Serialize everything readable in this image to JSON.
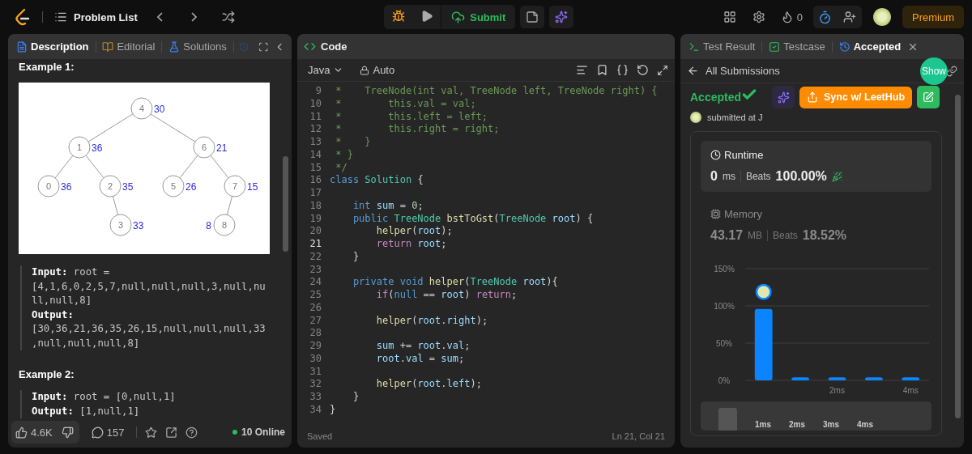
{
  "top_bar": {
    "title": "Problem List",
    "submit_label": "Submit",
    "streak": "0",
    "premium": "Premium"
  },
  "description_panel": {
    "tabs": [
      {
        "label": "Description",
        "kind": "description",
        "selected": true
      },
      {
        "label": "Editorial",
        "kind": "editorial",
        "selected": false
      },
      {
        "label": "Solutions",
        "kind": "solutions",
        "selected": false
      }
    ],
    "example_1": {
      "heading": "Example 1:",
      "tree": {
        "value": "4",
        "label": "30",
        "children": [
          {
            "right_child": false,
            "value": "1",
            "label": "36",
            "children": [
              {
                "right_child": false,
                "value": "0",
                "label": "36"
              },
              {
                "right_child": true,
                "value": "2",
                "label": "35",
                "children": [
                  {
                    "right_child": true,
                    "value": "3",
                    "label": "33"
                  }
                ]
              }
            ]
          },
          {
            "right_child": true,
            "value": "6",
            "label": "21",
            "children": [
              {
                "right_child": false,
                "value": "5",
                "label": "26"
              },
              {
                "right_child": true,
                "value": "7",
                "label": "15",
                "children": [
                  {
                    "right_child": false,
                    "value": "8",
                    "label": "8"
                  }
                ]
              }
            ]
          }
        ]
      },
      "lines": [
        "**Input:** root = [4,1,6,0,2,5,7,null,null,null,3,null,null,null,8]",
        "**Output:** [30,36,21,36,35,26,15,null,null,null,33,null,null,null,8]"
      ]
    },
    "example_2": {
      "heading": "Example 2:",
      "lines": [
        "**Input:** root = [0,null,1]",
        "**Output:** [1,null,1]"
      ]
    },
    "footer": {
      "likes": "4.6K",
      "comments": "157",
      "online": "10 Online"
    }
  },
  "code_panel": {
    "title": "Code",
    "language": "Java",
    "mode": "Auto",
    "lines": [
      {
        "num": "9",
        "current": false,
        "tokens": [
          {
            "kind": "comment",
            "text": " *    TreeNode(int val, TreeNode left, TreeNode right) {"
          }
        ]
      },
      {
        "num": "10",
        "current": false,
        "tokens": [
          {
            "kind": "comment",
            "text": " *        this.val = val;"
          }
        ]
      },
      {
        "num": "11",
        "current": false,
        "tokens": [
          {
            "kind": "comment",
            "text": " *        this.left = left;"
          }
        ]
      },
      {
        "num": "12",
        "current": false,
        "tokens": [
          {
            "kind": "comment",
            "text": " *        this.right = right;"
          }
        ]
      },
      {
        "num": "13",
        "current": false,
        "tokens": [
          {
            "kind": "comment",
            "text": " *    }"
          }
        ]
      },
      {
        "num": "14",
        "current": false,
        "tokens": [
          {
            "kind": "comment",
            "text": " * }"
          }
        ]
      },
      {
        "num": "15",
        "current": false,
        "tokens": [
          {
            "kind": "comment",
            "text": " */"
          }
        ]
      },
      {
        "num": "16",
        "current": false,
        "tokens": [
          {
            "kind": "keyword",
            "text": "class"
          },
          {
            "kind": "type",
            "text": " Solution"
          },
          {
            "kind": "plain",
            "text": " {"
          }
        ]
      },
      {
        "num": "17",
        "current": false
      },
      {
        "num": "18",
        "current": false,
        "tokens": [
          {
            "kind": "keyword",
            "text": "    int"
          },
          {
            "kind": "variable",
            "text": " sum"
          },
          {
            "kind": "plain",
            "text": " = "
          },
          {
            "kind": "number",
            "text": "0"
          },
          {
            "kind": "plain",
            "text": ";"
          }
        ]
      },
      {
        "num": "19",
        "current": false,
        "tokens": [
          {
            "kind": "keyword",
            "text": "    public"
          },
          {
            "kind": "type",
            "text": " TreeNode"
          },
          {
            "kind": "function",
            "text": " bstToGst"
          },
          {
            "kind": "plain",
            "text": "("
          },
          {
            "kind": "type",
            "text": "TreeNode"
          },
          {
            "kind": "variable",
            "text": " root"
          },
          {
            "kind": "plain",
            "text": ") {"
          }
        ]
      },
      {
        "num": "20",
        "current": false,
        "tokens": [
          {
            "kind": "function",
            "text": "        helper"
          },
          {
            "kind": "plain",
            "text": "("
          },
          {
            "kind": "variable",
            "text": "root"
          },
          {
            "kind": "plain",
            "text": ");"
          }
        ]
      },
      {
        "num": "21",
        "current": true,
        "tokens": [
          {
            "kind": "control",
            "text": "        return"
          },
          {
            "kind": "variable",
            "text": " root"
          },
          {
            "kind": "plain",
            "text": ";"
          }
        ]
      },
      {
        "num": "22",
        "current": false,
        "tokens": [
          {
            "kind": "plain",
            "text": "    }"
          }
        ]
      },
      {
        "num": "23",
        "current": false
      },
      {
        "num": "24",
        "current": false,
        "tokens": [
          {
            "kind": "keyword",
            "text": "    private void"
          },
          {
            "kind": "function",
            "text": " helper"
          },
          {
            "kind": "plain",
            "text": "("
          },
          {
            "kind": "type",
            "text": "TreeNode"
          },
          {
            "kind": "variable",
            "text": " root"
          },
          {
            "kind": "plain",
            "text": "){"
          }
        ]
      },
      {
        "num": "25",
        "current": false,
        "tokens": [
          {
            "kind": "control",
            "text": "        if"
          },
          {
            "kind": "plain",
            "text": "("
          },
          {
            "kind": "keyword",
            "text": "null"
          },
          {
            "kind": "plain",
            "text": " == "
          },
          {
            "kind": "variable",
            "text": "root"
          },
          {
            "kind": "plain",
            "text": ") "
          },
          {
            "kind": "control",
            "text": "return"
          },
          {
            "kind": "plain",
            "text": ";"
          }
        ]
      },
      {
        "num": "26",
        "current": false
      },
      {
        "num": "27",
        "current": false,
        "tokens": [
          {
            "kind": "function",
            "text": "        helper"
          },
          {
            "kind": "plain",
            "text": "("
          },
          {
            "kind": "variable",
            "text": "root"
          },
          {
            "kind": "plain",
            "text": "."
          },
          {
            "kind": "variable",
            "text": "right"
          },
          {
            "kind": "plain",
            "text": ");"
          }
        ]
      },
      {
        "num": "28",
        "current": false
      },
      {
        "num": "29",
        "current": false,
        "tokens": [
          {
            "kind": "variable",
            "text": "        sum"
          },
          {
            "kind": "plain",
            "text": " += "
          },
          {
            "kind": "variable",
            "text": "root"
          },
          {
            "kind": "plain",
            "text": "."
          },
          {
            "kind": "variable",
            "text": "val"
          },
          {
            "kind": "plain",
            "text": ";"
          }
        ]
      },
      {
        "num": "30",
        "current": false,
        "tokens": [
          {
            "kind": "variable",
            "text": "        root"
          },
          {
            "kind": "plain",
            "text": "."
          },
          {
            "kind": "variable",
            "text": "val"
          },
          {
            "kind": "plain",
            "text": " = "
          },
          {
            "kind": "variable",
            "text": "sum"
          },
          {
            "kind": "plain",
            "text": ";"
          }
        ]
      },
      {
        "num": "31",
        "current": false
      },
      {
        "num": "32",
        "current": false,
        "tokens": [
          {
            "kind": "function",
            "text": "        helper"
          },
          {
            "kind": "plain",
            "text": "("
          },
          {
            "kind": "variable",
            "text": "root"
          },
          {
            "kind": "plain",
            "text": "."
          },
          {
            "kind": "variable",
            "text": "left"
          },
          {
            "kind": "plain",
            "text": ");"
          }
        ]
      },
      {
        "num": "33",
        "current": false,
        "tokens": [
          {
            "kind": "plain",
            "text": "    }"
          }
        ]
      },
      {
        "num": "34",
        "current": false,
        "tokens": [
          {
            "kind": "plain",
            "text": "}"
          }
        ]
      }
    ],
    "status": "Saved",
    "cursor": "Ln 21, Col 21"
  },
  "result_panel": {
    "tabs": [
      {
        "label": "Test Result",
        "kind": "terminal",
        "selected": false,
        "closable": false
      },
      {
        "label": "Testcase",
        "kind": "testcase",
        "selected": false,
        "closable": false
      },
      {
        "label": "Accepted",
        "kind": "history",
        "selected": true,
        "closable": true
      }
    ],
    "back_link": "All Submissions",
    "show_button": "Show",
    "status": "Accepted",
    "sync_button": "Sync w/ LeetHub",
    "submitted": "submitted at J",
    "metrics": [
      {
        "kind": "runtime",
        "title": "Runtime",
        "value": "0",
        "unit": "ms",
        "beats_label": "Beats",
        "beats": "100.00%",
        "selected": true
      },
      {
        "kind": "memory",
        "title": "Memory",
        "value": "43.17",
        "unit": "MB",
        "beats_label": "Beats",
        "beats": "18.52%",
        "selected": false
      }
    ],
    "chart_data": {
      "type": "bar",
      "x": [
        0,
        1,
        2,
        3,
        4
      ],
      "values": [
        96,
        4,
        4,
        4,
        4
      ],
      "xlim": [
        -0.5,
        4.5
      ],
      "ylim": [
        0,
        150
      ],
      "yticks": [
        {
          "value": 0,
          "label": "0%"
        },
        {
          "value": 50,
          "label": "50%"
        },
        {
          "value": 100,
          "label": "100%"
        },
        {
          "value": 150,
          "label": "150%"
        }
      ],
      "xticks": [
        {
          "value": 2,
          "label": "2ms"
        },
        {
          "value": 4,
          "label": "4ms"
        }
      ]
    },
    "overview_labels": [
      "1ms",
      "2ms",
      "3ms",
      "4ms"
    ]
  }
}
